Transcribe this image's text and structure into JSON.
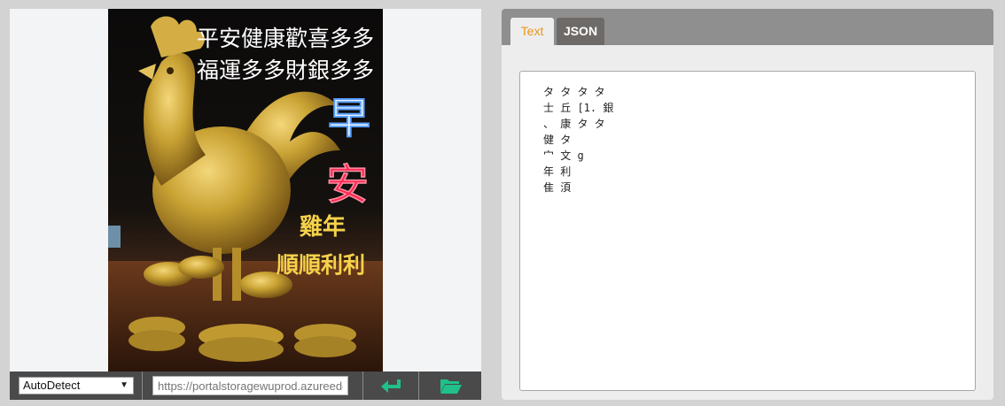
{
  "image": {
    "headline_line1": "平安健康歡喜多多",
    "headline_line2": "福運多多財銀多多",
    "greeting_char1": "早",
    "greeting_char2": "安",
    "year_text": "雞年",
    "wish_text": "順順利利",
    "colors": {
      "headline": "#ffffff",
      "greeting1": "#5aa0ff",
      "greeting2": "#ff2a4f",
      "gold_text": "#f6d24a",
      "rooster": "#c9a233"
    }
  },
  "toolbar": {
    "language": "AutoDetect",
    "url_placeholder": "https://portalstoragewuprod.azureedge.net",
    "submit_icon": "enter-icon",
    "open_icon": "folder-open-icon"
  },
  "tabs": [
    {
      "label": "Text",
      "active": true
    },
    {
      "label": "JSON",
      "active": false
    }
  ],
  "result_text": "タ タ タ タ\n士 丘 [1. 銀\n、 康 タ タ\n健 タ\n宀 文 g\n年 利\n隹 湏"
}
